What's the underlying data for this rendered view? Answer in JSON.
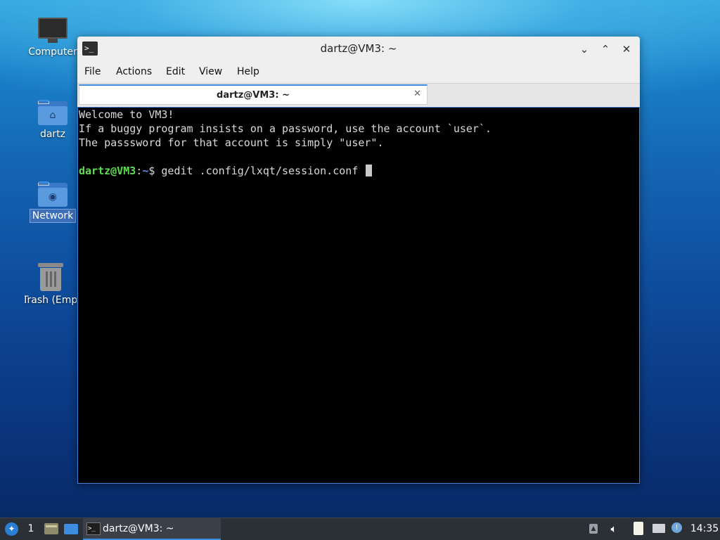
{
  "desktop": {
    "icons": [
      {
        "label": "Computer"
      },
      {
        "label": "dartz"
      },
      {
        "label": "Network"
      },
      {
        "label": "Trash (Empty)"
      }
    ]
  },
  "window": {
    "title": "dartz@VM3: ~",
    "app_icon": ">_",
    "controls": {
      "minimize": "⌄",
      "maximize": "⌃",
      "close": "✕"
    },
    "menu": [
      "File",
      "Actions",
      "Edit",
      "View",
      "Help"
    ],
    "tab": {
      "label": "dartz@VM3: ~",
      "close": "✕"
    }
  },
  "terminal": {
    "lines": [
      "Welcome to VM3!",
      "If a buggy program insists on a password, use the account `user`.",
      "The passsword for that account is simply \"user\"."
    ],
    "prompt": {
      "user_host": "dartz@VM3",
      "colon": ":",
      "path": "~",
      "symbol": "$ ",
      "command": "gedit .config/lxqt/session.conf "
    }
  },
  "taskbar": {
    "desktop_number": "1",
    "task_label": "dartz@VM3: ~",
    "clock": "14:35"
  },
  "colors": {
    "prompt_user": "#5fdc54",
    "prompt_path": "#6a8cf0",
    "accent": "#3d8ee0",
    "taskbar": "#2b2f36"
  }
}
